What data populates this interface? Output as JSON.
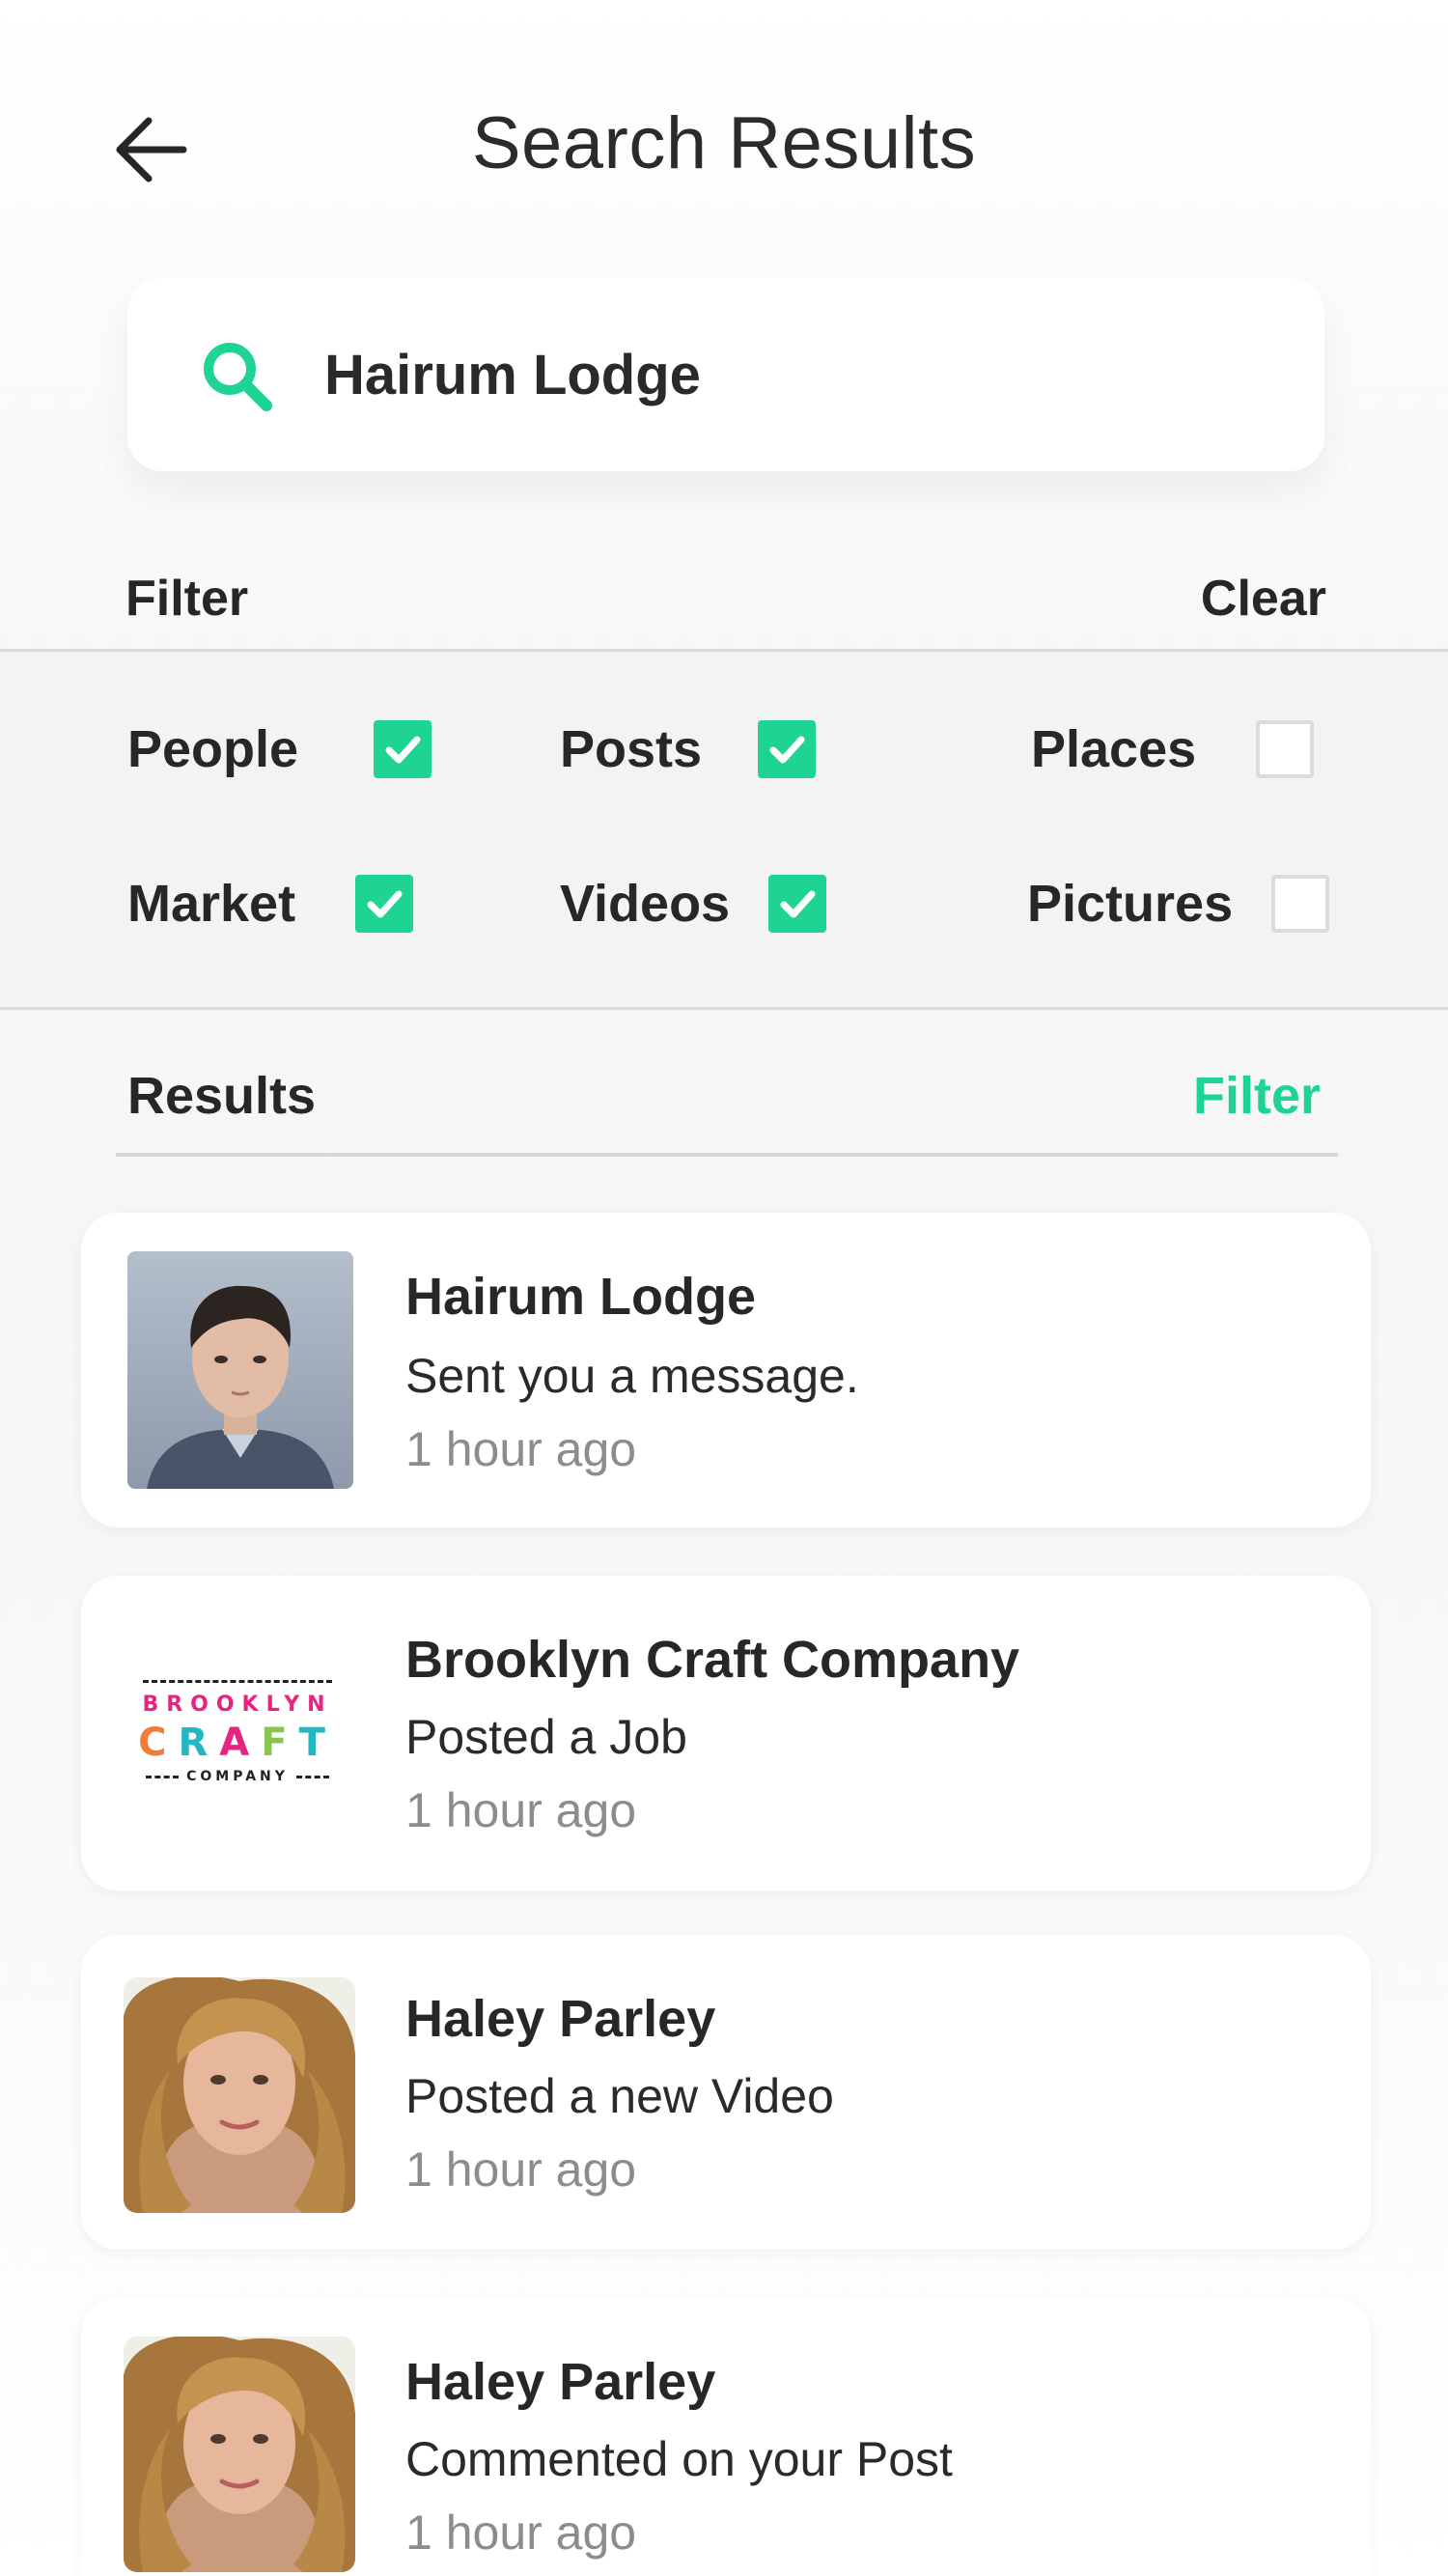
{
  "header": {
    "title": "Search Results"
  },
  "search": {
    "value": "Hairum Lodge",
    "icon": "search-icon"
  },
  "filter": {
    "label": "Filter",
    "clear_label": "Clear",
    "options": [
      {
        "label": "People",
        "checked": true
      },
      {
        "label": "Posts",
        "checked": true
      },
      {
        "label": "Places",
        "checked": false
      },
      {
        "label": "Market",
        "checked": true
      },
      {
        "label": "Videos",
        "checked": true
      },
      {
        "label": "Pictures",
        "checked": false
      }
    ]
  },
  "results": {
    "label": "Results",
    "filter_label": "Filter",
    "items": [
      {
        "title": "Hairum Lodge",
        "subtitle": "Sent you a message.",
        "time": "1 hour ago",
        "avatar": "man-portrait"
      },
      {
        "title": "Brooklyn Craft Company",
        "subtitle": "Posted a Job",
        "time": "1 hour ago",
        "avatar": "brooklyn-craft-logo",
        "logo_lines": [
          "BROOKLYN",
          "CRAFT",
          "COMPANY"
        ]
      },
      {
        "title": "Haley Parley",
        "subtitle": "Posted a new Video",
        "time": "1 hour ago",
        "avatar": "woman-portrait"
      },
      {
        "title": "Haley Parley",
        "subtitle": "Commented on your Post",
        "time": "1 hour ago",
        "avatar": "woman-portrait"
      }
    ]
  },
  "colors": {
    "accent": "#1fd392",
    "text": "#2a2a2a",
    "muted": "#8c8c8c"
  }
}
